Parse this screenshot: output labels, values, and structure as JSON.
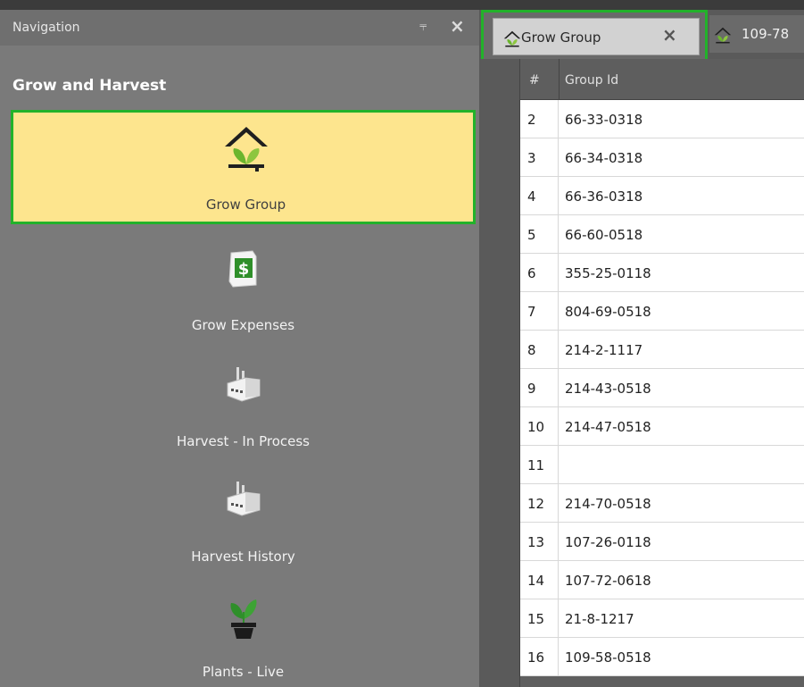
{
  "navigation": {
    "title": "Navigation",
    "pin_glyph": "⫧",
    "close_glyph": "×",
    "group_title": "Grow and Harvest",
    "items": [
      {
        "label": "Grow Group",
        "icon": "greenhouse-plant-icon",
        "selected": true
      },
      {
        "label": "Grow Expenses",
        "icon": "money-bag-icon",
        "selected": false
      },
      {
        "label": "Harvest - In Process",
        "icon": "factory-icon",
        "selected": false
      },
      {
        "label": "Harvest History",
        "icon": "factory-icon",
        "selected": false
      },
      {
        "label": "Plants - Live",
        "icon": "potted-plant-icon",
        "selected": false
      }
    ]
  },
  "tabs": [
    {
      "label": "Grow Group",
      "close_glyph": "×",
      "active": true,
      "icon": "greenhouse-plant-icon"
    },
    {
      "label": "109-78",
      "active": false,
      "icon": "greenhouse-plant-icon"
    }
  ],
  "grid": {
    "columns": [
      "#",
      "Group Id"
    ],
    "rows": [
      {
        "num": "2",
        "group_id": "66-33-0318"
      },
      {
        "num": "3",
        "group_id": "66-34-0318"
      },
      {
        "num": "4",
        "group_id": "66-36-0318"
      },
      {
        "num": "5",
        "group_id": "66-60-0518"
      },
      {
        "num": "6",
        "group_id": "355-25-0118"
      },
      {
        "num": "7",
        "group_id": "804-69-0518"
      },
      {
        "num": "8",
        "group_id": "214-2-1117"
      },
      {
        "num": "9",
        "group_id": "214-43-0518"
      },
      {
        "num": "10",
        "group_id": "214-47-0518"
      },
      {
        "num": "11",
        "group_id": ""
      },
      {
        "num": "12",
        "group_id": "214-70-0518"
      },
      {
        "num": "13",
        "group_id": "107-26-0118"
      },
      {
        "num": "14",
        "group_id": "107-72-0618"
      },
      {
        "num": "15",
        "group_id": "21-8-1217"
      },
      {
        "num": "16",
        "group_id": "109-58-0518"
      }
    ]
  },
  "colors": {
    "selection_border": "#22b22a",
    "selected_item_bg": "#fde58e",
    "panel_bg": "#7a7a7a"
  }
}
